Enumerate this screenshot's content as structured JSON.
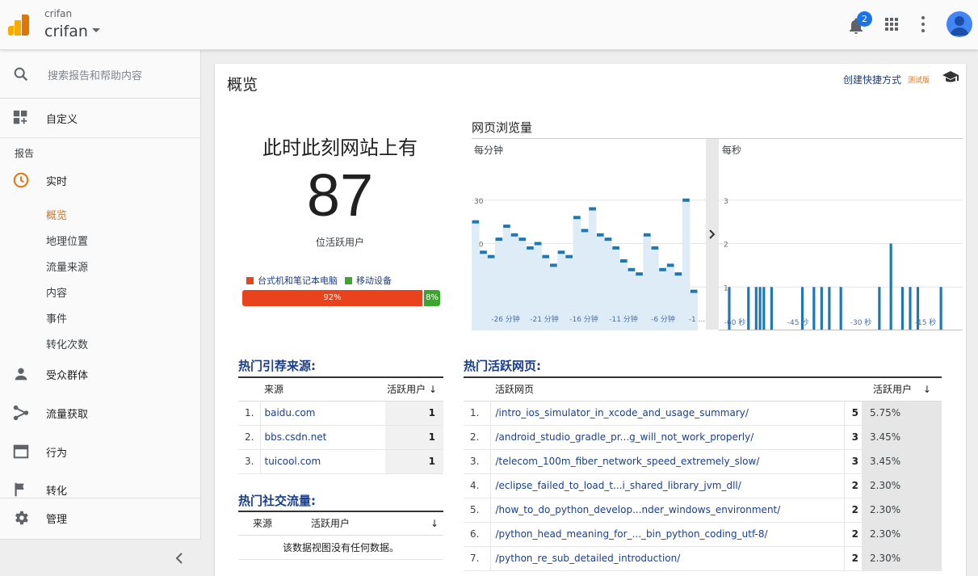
{
  "header": {
    "account_small": "crifan",
    "account_name": "crifan",
    "notification_count": "2"
  },
  "sidebar": {
    "search_placeholder": "搜索报告和帮助内容",
    "customize": "自定义",
    "reports_label": "报告",
    "realtime": "实时",
    "realtime_items": [
      "概览",
      "地理位置",
      "流量来源",
      "内容",
      "事件",
      "转化次数"
    ],
    "audience": "受众群体",
    "acquisition": "流量获取",
    "behavior": "行为",
    "conversions": "转化",
    "admin": "管理"
  },
  "main": {
    "title": "概览",
    "create_shortcut": "创建快捷方式",
    "beta": "测试版",
    "active_now_heading": "此时此刻网站上有",
    "active_users": "87",
    "active_users_label": "位活跃用户",
    "legend": {
      "desktop": "台式机和笔记本电脑",
      "mobile": "移动设备",
      "desktop_color": "#e8431d",
      "mobile_color": "#3aa62e"
    },
    "split": {
      "desktop_pct": 92,
      "mobile_pct": 8,
      "desktop_label": "92%",
      "mobile_label": "8%"
    },
    "pageviews": {
      "title": "网页浏览量",
      "per_minute_label": "每分钟",
      "per_second_label": "每秒",
      "minute_y_ticks": [
        "30",
        "20",
        "10"
      ],
      "minute_x_ticks": [
        "-26 分钟",
        "-21 分钟",
        "-16 分钟",
        "-11 分钟",
        "-6 分钟",
        "-1 ..."
      ],
      "second_y_ticks": [
        "3",
        "2",
        "1"
      ],
      "second_x_ticks": [
        "-60 秒",
        "-45 秒",
        "-30 秒",
        "-15 秒"
      ]
    },
    "top_referrals": {
      "title": "热门引荐来源:",
      "col_source": "来源",
      "col_active": "活跃用户",
      "rows": [
        {
          "rank": "1.",
          "source": "baidu.com",
          "active": "1"
        },
        {
          "rank": "2.",
          "source": "bbs.csdn.net",
          "active": "1"
        },
        {
          "rank": "3.",
          "source": "tuicool.com",
          "active": "1"
        }
      ]
    },
    "top_social": {
      "title": "热门社交流量:",
      "col_source": "来源",
      "col_active": "活跃用户",
      "empty": "该数据视图没有任何数据。"
    },
    "top_pages": {
      "title": "热门活跃网页:",
      "col_page": "活跃网页",
      "col_active": "活跃用户",
      "rows": [
        {
          "rank": "1.",
          "page": "/intro_ios_simulator_in_xcode_and_usage_summary/",
          "active": "5",
          "pct": "5.75%"
        },
        {
          "rank": "2.",
          "page": "/android_studio_gradle_pr...g_will_not_work_properly/",
          "active": "3",
          "pct": "3.45%"
        },
        {
          "rank": "3.",
          "page": "/telecom_100m_fiber_network_speed_extremely_slow/",
          "active": "3",
          "pct": "3.45%"
        },
        {
          "rank": "4.",
          "page": "/eclipse_failed_to_load_t...i_shared_library_jvm_dll/",
          "active": "2",
          "pct": "2.30%"
        },
        {
          "rank": "5.",
          "page": "/how_to_do_python_develop...nder_windows_environment/",
          "active": "2",
          "pct": "2.30%"
        },
        {
          "rank": "6.",
          "page": "/python_head_meaning_for_..._bin_python_coding_utf-8/",
          "active": "2",
          "pct": "2.30%"
        },
        {
          "rank": "7.",
          "page": "/python_re_sub_detailed_introduction/",
          "active": "2",
          "pct": "2.30%"
        }
      ]
    }
  },
  "chart_data": [
    {
      "type": "area",
      "title": "每分钟",
      "ylim": [
        0,
        40
      ],
      "x_ticks": [
        "-26 分钟",
        "-21 分钟",
        "-16 分钟",
        "-11 分钟",
        "-6 分钟",
        "-1 ..."
      ],
      "values": [
        25,
        18,
        17,
        21,
        24,
        22,
        21,
        19,
        20,
        17,
        15,
        18,
        17,
        26,
        23,
        28,
        22,
        21,
        19,
        16,
        14,
        13,
        22,
        19,
        14,
        15,
        13,
        30,
        9
      ]
    },
    {
      "type": "bar",
      "title": "每秒",
      "ylim": [
        0,
        4
      ],
      "x_ticks": [
        "-60 秒",
        "-45 秒",
        "-30 秒",
        "-15 秒"
      ],
      "values": [
        0,
        1,
        0,
        0,
        0,
        0,
        1,
        0,
        1,
        1,
        1,
        0,
        1,
        0,
        0,
        0,
        0,
        0,
        0,
        0,
        1,
        0,
        0,
        1,
        0,
        1,
        0,
        1,
        0,
        0,
        1,
        0,
        0,
        0,
        0,
        0,
        0,
        0,
        0,
        0,
        1,
        0,
        0,
        2,
        0,
        0,
        1,
        0,
        1,
        0,
        1,
        0,
        0,
        0,
        0,
        0,
        1,
        0,
        0,
        0
      ]
    }
  ]
}
